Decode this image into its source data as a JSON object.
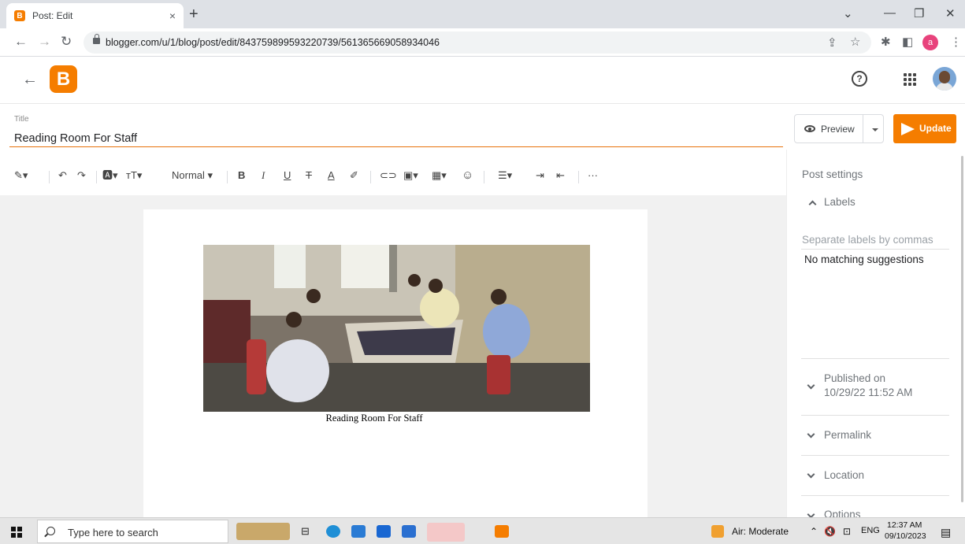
{
  "browser": {
    "tab_title": "Post: Edit",
    "tab_close": "×",
    "new_tab": "+",
    "url": "blogger.com/u/1/blog/post/edit/843759899593220739/5613656690589340​46",
    "profile_initial": "a",
    "window_controls": [
      "⌄",
      "—",
      "❐",
      "✕"
    ]
  },
  "header": {
    "help_icon": "?"
  },
  "post": {
    "title_label": "Title",
    "title": "Reading Room For Staff",
    "image_caption": "Reading Room For Staff"
  },
  "actions": {
    "preview": "Preview",
    "update": "Update"
  },
  "toolbar": {
    "paragraph_style": "Normal",
    "more": "···"
  },
  "sidebar": {
    "heading": "Post settings",
    "labels_section": "Labels",
    "labels_placeholder": "Separate labels by commas",
    "labels_suggestion": "No matching suggestions",
    "published_on_label": "Published on",
    "published_on_value": "10/29/22 11:52 AM",
    "permalink": "Permalink",
    "location": "Location",
    "options": "Options"
  },
  "taskbar": {
    "search_placeholder": "Type here to search",
    "weather": "Air: Moderate",
    "language": "ENG",
    "time": "12:37 AM",
    "date": "09/10/2023"
  },
  "colors": {
    "accent": "#f57d00",
    "title_underline": "#e8710a"
  }
}
